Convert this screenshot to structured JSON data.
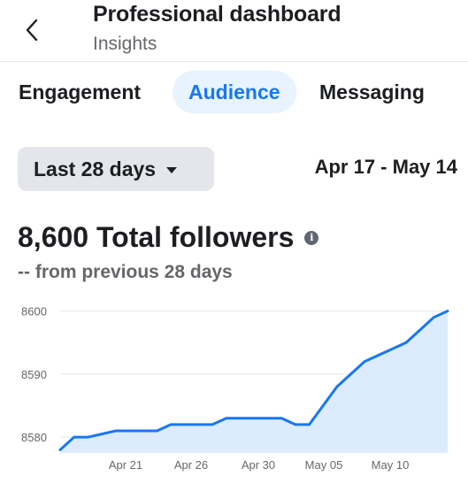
{
  "header": {
    "title": "Professional dashboard",
    "subtitle": "Insights"
  },
  "tabs": [
    {
      "label": "Engagement",
      "selected": false
    },
    {
      "label": "Audience",
      "selected": true
    },
    {
      "label": "Messaging",
      "selected": false
    }
  ],
  "filter": {
    "range_label": "Last 28 days",
    "date_range": "Apr 17 - May 14"
  },
  "metric": {
    "total_label": "8,600 Total followers",
    "comparison": "-- from previous 28 days",
    "info_icon": "i"
  },
  "colors": {
    "accent": "#1877f2",
    "area_fill": "#dcebfd",
    "tab_selected_bg": "#e7f3ff"
  },
  "chart_data": {
    "type": "area",
    "x": [
      "Apr 17",
      "Apr 18",
      "Apr 19",
      "Apr 20",
      "Apr 21",
      "Apr 22",
      "Apr 23",
      "Apr 24",
      "Apr 25",
      "Apr 26",
      "Apr 27",
      "Apr 28",
      "Apr 29",
      "Apr 30",
      "May 01",
      "May 02",
      "May 03",
      "May 04",
      "May 05",
      "May 06",
      "May 07",
      "May 08",
      "May 09",
      "May 10",
      "May 11",
      "May 12",
      "May 13",
      "May 14"
    ],
    "series": [
      {
        "values": [
          8578,
          8580,
          8580,
          8580.5,
          8581,
          8581,
          8581,
          8581,
          8582,
          8582,
          8582,
          8582,
          8583,
          8583,
          8583,
          8583,
          8583,
          8582,
          8582,
          8585,
          8588,
          8590,
          8592,
          8593,
          8594,
          8595,
          8597,
          8599,
          8600
        ]
      }
    ],
    "x_ticks": [
      "Apr 21",
      "Apr 26",
      "Apr 30",
      "May 05",
      "May 10"
    ],
    "y_ticks": [
      8580,
      8590,
      8600
    ],
    "ylim": [
      8577.5,
      8600.5
    ],
    "grid": true
  }
}
